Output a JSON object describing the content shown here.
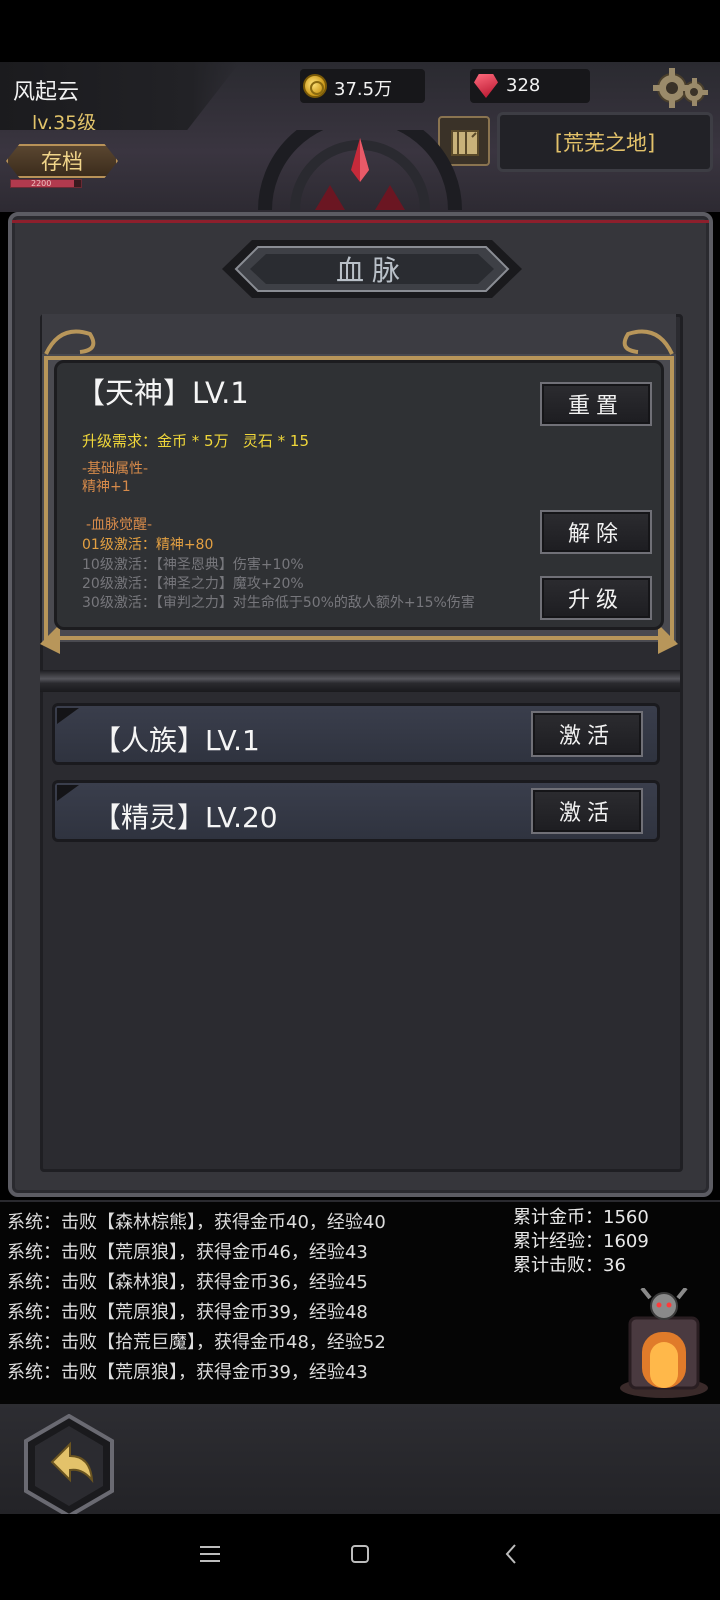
{
  "player": {
    "name": "风起云",
    "level": "lv.35级",
    "save_label": "存档",
    "exp_text": "2200",
    "exp_fraction": 0.9
  },
  "currency": {
    "gold": "37.5万",
    "gems": "328"
  },
  "area": {
    "name": "[荒芜之地]"
  },
  "panel": {
    "title": "血脉"
  },
  "bloodline": {
    "title": "【天神】LV.1",
    "requirement": "升级需求：金币 * 5万   灵石 * 15",
    "base_attr_heading": "-基础属性-",
    "base_attr": "精神+1",
    "awaken_heading": "-血脉觉醒-",
    "awakenings": [
      {
        "text": "01级激活：精神+80",
        "active": true
      },
      {
        "text": "10级激活：【神圣恩典】伤害+10%",
        "active": false
      },
      {
        "text": "20级激活：【神圣之力】魔攻+20%",
        "active": false
      },
      {
        "text": "30级激活：【审判之力】对生命低于50%的敌人额外+15%伤害",
        "active": false
      }
    ],
    "reset_label": "重置",
    "remove_label": "解除",
    "upgrade_label": "升级"
  },
  "other_bloodlines": [
    {
      "title": "【人族】LV.1",
      "action_label": "激活"
    },
    {
      "title": "【精灵】LV.20",
      "action_label": "激活"
    }
  ],
  "log": [
    "系统：击败【森林棕熊】，获得金币40，经验40",
    "系统：击败【荒原狼】，获得金币46，经验43",
    "系统：击败【森林狼】，获得金币36，经验45",
    "系统：击败【荒原狼】，获得金币39，经验48",
    "系统：击败【拾荒巨魔】，获得金币48，经验52",
    "系统：击败【荒原狼】，获得金币39，经验43"
  ],
  "stats": {
    "gold": "累计金币：1560",
    "exp": "累计经验：1609",
    "kills": "累计击败：36"
  },
  "colors": {
    "accent_gold": "#e3c26a",
    "requirement_yellow": "#f0d73a",
    "attribute_orange": "#d68a4a",
    "inactive_gray": "#77777c",
    "frame_bronze": "#b8965a"
  },
  "icons": [
    "coin-icon",
    "gem-icon",
    "gear-icon",
    "map-icon",
    "back-arrow-icon",
    "menu-icon",
    "home-square-icon",
    "back-chevron-icon",
    "portal-icon"
  ]
}
